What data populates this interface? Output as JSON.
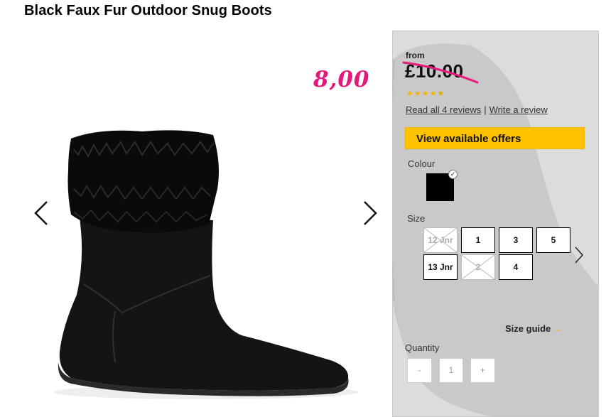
{
  "product": {
    "title": "Black Faux Fur Outdoor Snug Boots",
    "image_alt": "boot-image"
  },
  "annotation": {
    "handwritten_price": "8,00",
    "color": "#e6197a"
  },
  "pricing": {
    "from_label": "from",
    "price": "£10.00",
    "strikethrough": true
  },
  "rating": {
    "stars_filled": 4.5,
    "stars_total": 5
  },
  "reviews": {
    "read_label": "Read all 4 reviews",
    "separator": "|",
    "write_label": "Write a review"
  },
  "offers_button": {
    "label": "View available offers",
    "color": "#ffc200"
  },
  "colour": {
    "label": "Colour",
    "selected": "Black",
    "check": "✓"
  },
  "size": {
    "label": "Size",
    "options": [
      {
        "label": "12 Jnr",
        "available": false
      },
      {
        "label": "1",
        "available": true
      },
      {
        "label": "3",
        "available": true
      },
      {
        "label": "5",
        "available": true
      },
      {
        "label": "13 Jnr",
        "available": true
      },
      {
        "label": "2",
        "available": false
      },
      {
        "label": "4",
        "available": true
      }
    ]
  },
  "size_guide": {
    "label": "Size guide",
    "arrow": "→"
  },
  "quantity": {
    "label": "Quantity",
    "minus": "-",
    "value": "1",
    "plus": "+"
  }
}
